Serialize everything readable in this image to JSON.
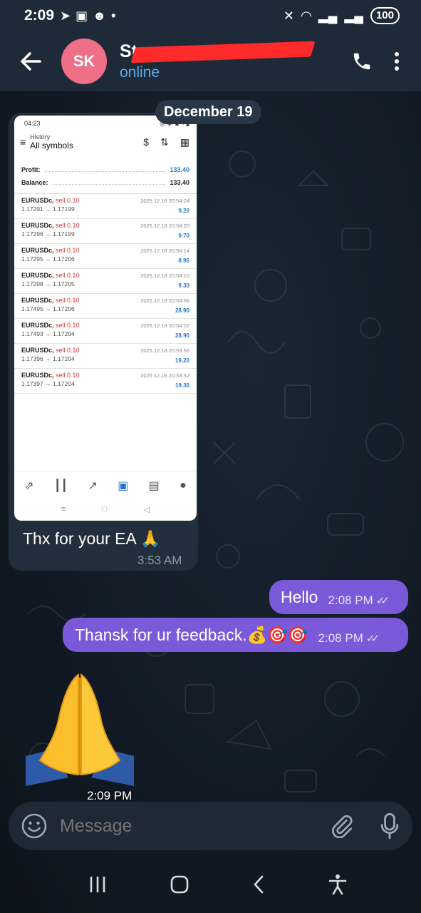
{
  "status_bar": {
    "time": "2:09",
    "battery": "100"
  },
  "header": {
    "avatar_initials": "SK",
    "contact_name": "St",
    "contact_status": "online"
  },
  "chat": {
    "date_separator": "December 19",
    "incoming": {
      "text": "Thx for your EA 🙏",
      "time": "3:53 AM",
      "screenshot": {
        "status_time": "04:23",
        "title_small": "History",
        "title": "All symbols",
        "profit_label": "Profit:",
        "profit_value": "133.40",
        "balance_label": "Balance:",
        "balance_value": "133.40",
        "trades": [
          {
            "symbol": "EURUSDc,",
            "side": "sell 0.10",
            "prices": "1.17291 → 1.17199",
            "date": "2025.12.18 20:54:24",
            "pl": "9.20"
          },
          {
            "symbol": "EURUSDc,",
            "side": "sell 0.10",
            "prices": "1.17296 → 1.17199",
            "date": "2025.12.18 20:54:20",
            "pl": "9.70"
          },
          {
            "symbol": "EURUSDc,",
            "side": "sell 0.10",
            "prices": "1.17295 → 1.17206",
            "date": "2025.12.18 20:54:14",
            "pl": "8.90"
          },
          {
            "symbol": "EURUSDc,",
            "side": "sell 0.10",
            "prices": "1.17298 → 1.17205",
            "date": "2025.12.18 20:54:10",
            "pl": "9.30"
          },
          {
            "symbol": "EURUSDc,",
            "side": "sell 0.10",
            "prices": "1.17495 → 1.17206",
            "date": "2025.12.18 20:54:06",
            "pl": "28.90"
          },
          {
            "symbol": "EURUSDc,",
            "side": "sell 0.10",
            "prices": "1.17493 → 1.17204",
            "date": "2025.12.18 20:54:02",
            "pl": "28.90"
          },
          {
            "symbol": "EURUSDc,",
            "side": "sell 0.10",
            "prices": "1.17396 → 1.17204",
            "date": "2025.12.18 20:53:56",
            "pl": "19.20"
          },
          {
            "symbol": "EURUSDc,",
            "side": "sell 0.10",
            "prices": "1.17397 → 1.17204",
            "date": "2025.12.18 20:53:52",
            "pl": "19.30"
          }
        ]
      }
    },
    "outgoing": [
      {
        "text": "Hello",
        "time": "2:08 PM"
      },
      {
        "text": "Thansk for ur feedback.💰🎯🎯",
        "time": "2:08 PM"
      }
    ],
    "emoji_message": {
      "emoji": "🙏",
      "time": "2:09 PM"
    }
  },
  "composer": {
    "placeholder": "Message"
  },
  "colors": {
    "outgoing_bubble": "#7a5ad8",
    "incoming_bubble": "#222e3b",
    "header_bg": "#1e2a37",
    "online": "#5fa8e8",
    "avatar": "#ef6f86"
  }
}
